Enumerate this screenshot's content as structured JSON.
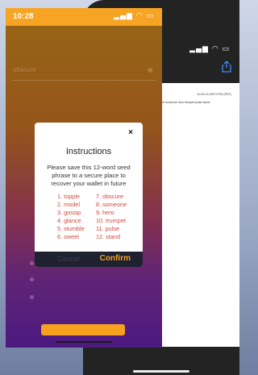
{
  "back_screen": {
    "signal_icons": "▂▄▆ ◠ ▭",
    "title_fragment": "cret",
    "share_icon": "share-icon",
    "timestamp": "10:28 13 GMT-0700 (PDT)",
    "phrase_line": "obscure someone hero trumpet pulse stand"
  },
  "front_screen": {
    "time": "10:28",
    "signal_icons": "▂▄▆ ◠ ▭",
    "bg_field_placeholder": "obscure",
    "bg_field_icon": "eye-icon"
  },
  "modal": {
    "close_label": "×",
    "title": "Instructions",
    "message": "Please save this 12-word seed phrase to a secure place to recover your wallet in future",
    "words_col1": [
      "1. topple",
      "2. model",
      "3. gossip",
      "4. glance",
      "5. stumble",
      "6. sweet"
    ],
    "words_col2": [
      "7. obscure",
      "8. someone",
      "9. hero",
      "10. trumpet",
      "11. pulse",
      "12. stand"
    ],
    "cancel_label": "Cancel",
    "confirm_label": "Confirm"
  },
  "colors": {
    "accent": "#f6a21f",
    "word_color": "#d6453a",
    "footer_bg": "#1d2130"
  }
}
